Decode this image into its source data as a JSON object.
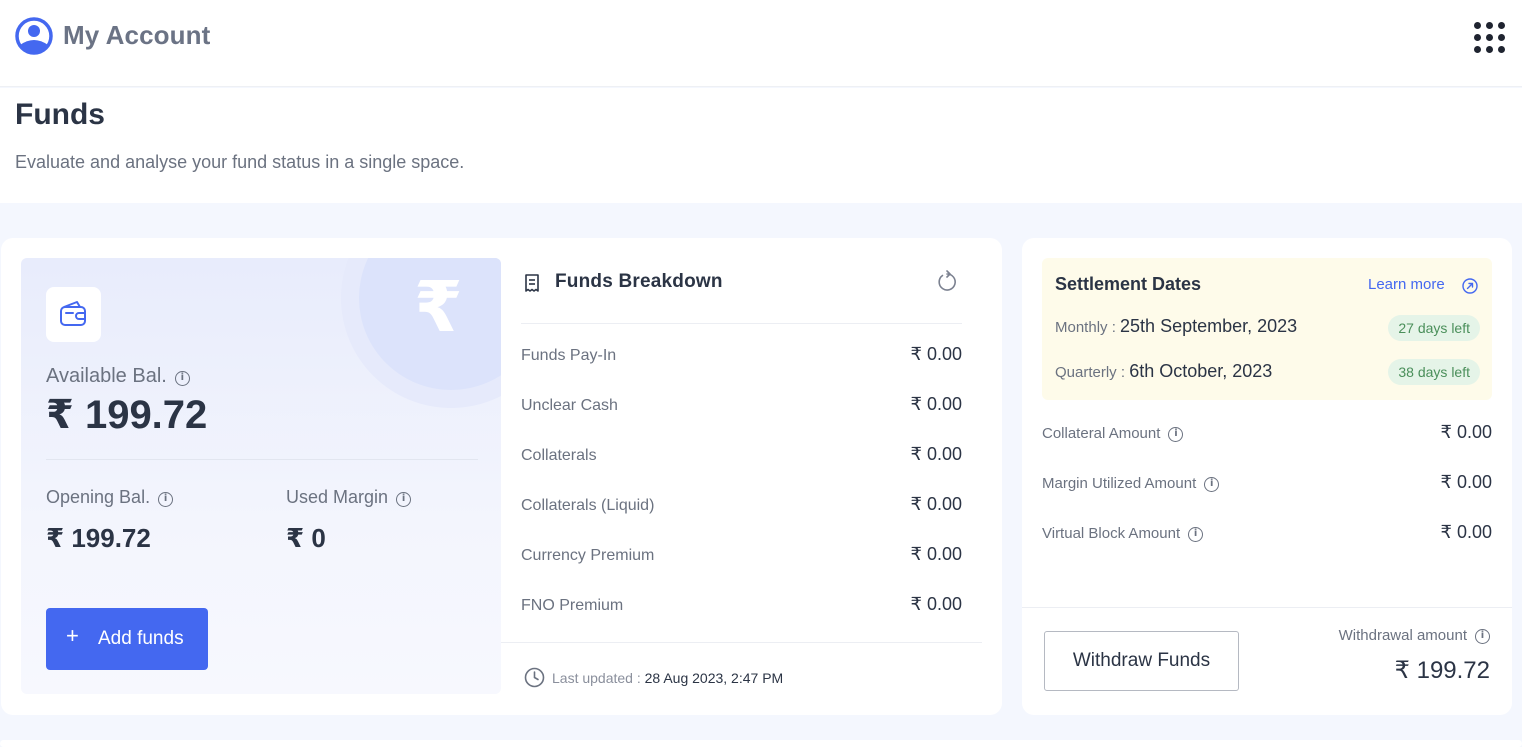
{
  "app": {
    "title": "My Account"
  },
  "page": {
    "title": "Funds",
    "subtitle": "Evaluate and analyse your fund status in a single space."
  },
  "balance": {
    "available_label": "Available Bal.",
    "available_value": "₹ 199.72",
    "opening_label": "Opening Bal.",
    "opening_value": "₹ 199.72",
    "used_margin_label": "Used Margin",
    "used_margin_value": "₹ 0",
    "add_funds_plus": "+",
    "add_funds_label": "Add funds",
    "decor_symbol": "₹"
  },
  "breakdown": {
    "title": "Funds Breakdown",
    "rows": [
      {
        "label": "Funds Pay-In",
        "value": "₹ 0.00"
      },
      {
        "label": "Unclear Cash",
        "value": "₹ 0.00"
      },
      {
        "label": "Collaterals",
        "value": "₹ 0.00"
      },
      {
        "label": "Collaterals (Liquid)",
        "value": "₹ 0.00"
      },
      {
        "label": "Currency Premium",
        "value": "₹ 0.00"
      },
      {
        "label": "FNO Premium",
        "value": "₹ 0.00"
      }
    ],
    "last_updated_label": "Last updated : ",
    "last_updated_value": "28 Aug 2023, 2:47 PM"
  },
  "settlement": {
    "title": "Settlement Dates",
    "learn_more": "Learn more",
    "monthly_label": "Monthly : ",
    "monthly_date": "25th September, 2023",
    "monthly_badge": "27 days left",
    "quarterly_label": "Quarterly : ",
    "quarterly_date": "6th October, 2023",
    "quarterly_badge": "38 days left"
  },
  "amounts": {
    "rows": [
      {
        "label": "Collateral Amount",
        "value": "₹ 0.00"
      },
      {
        "label": "Margin Utilized Amount",
        "value": "₹ 0.00"
      },
      {
        "label": "Virtual Block Amount",
        "value": "₹ 0.00"
      }
    ],
    "withdraw_button": "Withdraw Funds",
    "withdrawal_label": "Withdrawal amount",
    "withdrawal_value": "₹ 199.72"
  },
  "icons": {
    "logo": "user-circle-icon",
    "apps": "grid-dots-icon",
    "wallet": "wallet-icon",
    "info": "info-icon",
    "receipt": "receipt-icon",
    "refresh": "refresh-icon",
    "clock": "clock-icon",
    "external": "external-link-icon"
  },
  "colors": {
    "primary": "#4468f0",
    "badge_bg": "#e5f4e8",
    "badge_text": "#4a8f5a",
    "settlement_bg": "#fefbea"
  }
}
